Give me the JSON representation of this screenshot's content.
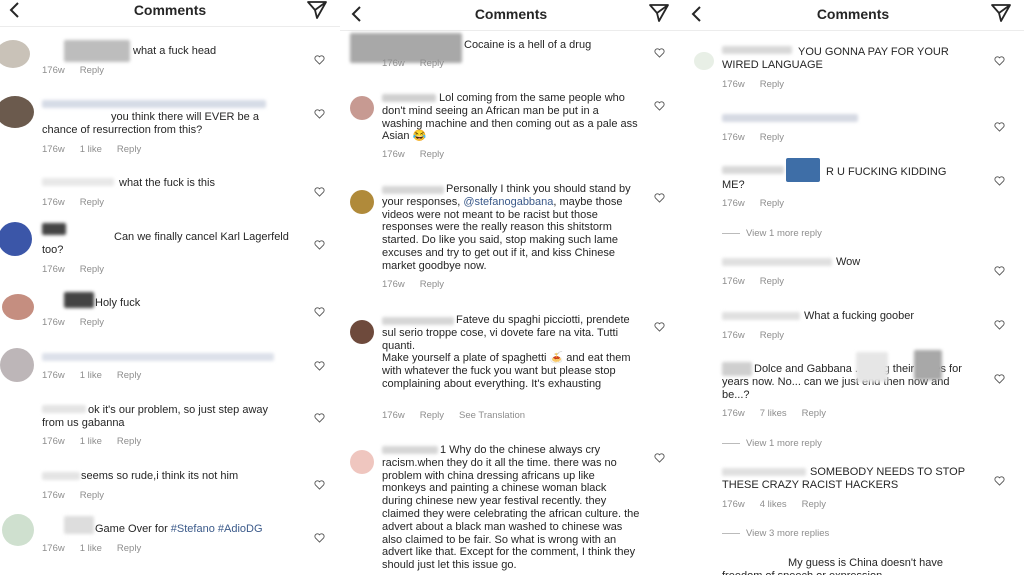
{
  "header": {
    "title": "Comments"
  },
  "panel1": {
    "comments": [
      {
        "text": "what a fuck head",
        "time": "176w",
        "likes": "",
        "reply": "Reply"
      },
      {
        "text": "you think there will EVER be a chance of resurrection from this?",
        "time": "176w",
        "likes": "1 like",
        "reply": "Reply"
      },
      {
        "text": "what the fuck is this",
        "time": "176w",
        "likes": "",
        "reply": "Reply"
      },
      {
        "text": "Can we finally cancel Karl Lagerfeld too?",
        "time": "176w",
        "likes": "",
        "reply": "Reply"
      },
      {
        "text": "Holy fuck",
        "time": "176w",
        "likes": "",
        "reply": "Reply"
      },
      {
        "text": "",
        "time": "176w",
        "likes": "1 like",
        "reply": "Reply"
      },
      {
        "text": "ok it's our problem, so just step away from us gabanna",
        "time": "176w",
        "likes": "1 like",
        "reply": "Reply"
      },
      {
        "text": "seems so rude,i think its not him",
        "time": "176w",
        "likes": "",
        "reply": "Reply"
      },
      {
        "text": "Game Over for ",
        "mention": "#Stefano #AdioDG",
        "time": "176w",
        "likes": "1 like",
        "reply": "Reply"
      }
    ]
  },
  "panel2": {
    "comments": [
      {
        "text": "Cocaine is a hell of a drug",
        "time": "176w",
        "reply": "Reply"
      },
      {
        "text": "Lol coming from the same people who don't mind seeing an African man be put in a washing machine and then coming out as a pale ass Asian 😂",
        "time": "176w",
        "reply": "Reply"
      },
      {
        "text_a": "Personally I think you should stand by your responses, ",
        "mention": "@stefanogabbana",
        "text_b": ", maybe those videos were not meant to be racist but those responses were the really reason this shitstorm started. Do like you said, stop making such lame excuses and try to get out if it, and kiss Chinese market goodbye now.",
        "time": "176w",
        "reply": "Reply"
      },
      {
        "text": "Fateve du spaghi picciotti, prendete sul serio troppe cose, vi dovete fare na vita. Tutti quanti.",
        "text2": "Make yourself a plate of spaghetti 🍝 and eat them with whatever the fuck you want but please stop complaining about everything. It's exhausting",
        "time": "176w",
        "reply": "Reply",
        "translate": "See Translation"
      },
      {
        "text": "1 Why do the chinese always cry racism.when they do it all the time. there was no problem with china dressing africans up like monkeys and painting a chinese woman black during chinese new year festival recently. they claimed they were celebrating the african culture. the advert about a black man washed to chinese was also claimed to be fair. So what is wrong with an advert like that. Except for the comment, I think they should just let this issue go."
      }
    ]
  },
  "panel3": {
    "comments": [
      {
        "text": "YOU GONNA PAY FOR YOUR WIRED LANGUAGE",
        "time": "176w",
        "reply": "Reply"
      },
      {
        "text": "",
        "time": "176w",
        "reply": "Reply"
      },
      {
        "text": "R U FUCKING KIDDING ME?",
        "time": "176w",
        "reply": "Reply",
        "view_more": "View 1 more reply"
      },
      {
        "text": "Wow",
        "time": "176w",
        "reply": "Reply"
      },
      {
        "text": "What a fucking goober",
        "time": "176w",
        "reply": "Reply"
      },
      {
        "text": "Dolce and Gabbana ... wing their asses for years now. No... can we just end then now and be...?",
        "time": "176w",
        "likes": "7 likes",
        "reply": "Reply",
        "view_more": "View 1 more reply"
      },
      {
        "text": "SOMEBODY NEEDS TO STOP THESE CRAZY RACIST HACKERS",
        "time": "176w",
        "likes": "4 likes",
        "reply": "Reply",
        "view_more": "View 3 more replies"
      },
      {
        "text": "My guess is China doesn't have freedom of speech or expression"
      }
    ]
  },
  "colors": {
    "text": "#262626",
    "muted": "#8e8e8e",
    "mention": "#3b5a8a",
    "bg": "#ffffff"
  },
  "icons": {
    "back": "chevron-left-icon",
    "send": "paper-plane-icon",
    "like": "heart-icon"
  }
}
